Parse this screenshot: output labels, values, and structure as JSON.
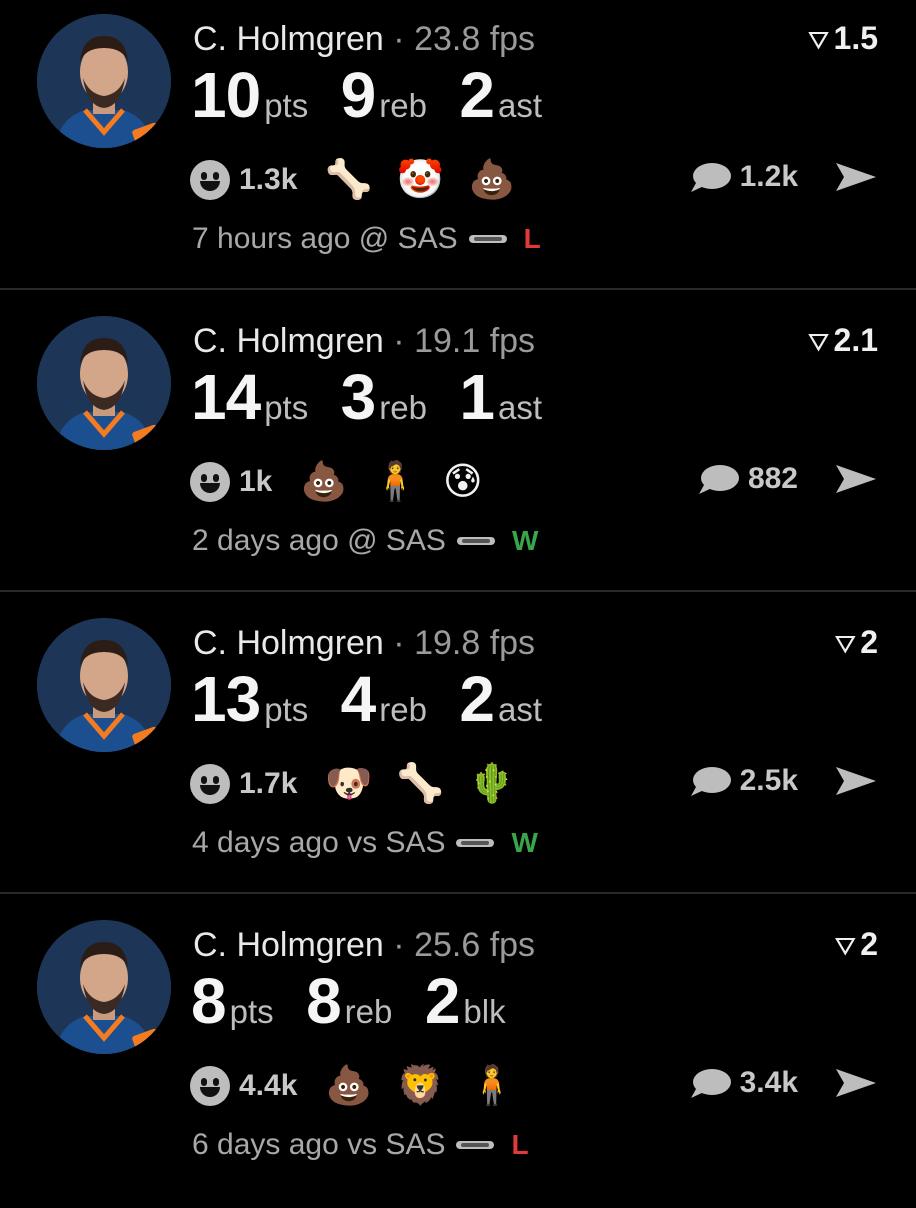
{
  "colors": {
    "win": "#3aa64a",
    "loss": "#e03a3a",
    "muted": "#a8a8a8"
  },
  "cards": [
    {
      "player": "C. Holmgren",
      "separator": "·",
      "fps": "23.8 fps",
      "rank_icon": "funnel-icon",
      "rank": "1.5",
      "stats": [
        {
          "num": "10",
          "unit": "pts"
        },
        {
          "num": "9",
          "unit": "reb"
        },
        {
          "num": "2",
          "unit": "ast"
        }
      ],
      "reaction_count": "1.3k",
      "reactions": [
        "🦴",
        "🤡",
        "💩"
      ],
      "comment_count": "1.2k",
      "time": "7 hours ago @ SAS",
      "result": "L"
    },
    {
      "player": "C. Holmgren",
      "separator": "·",
      "fps": "19.1 fps",
      "rank_icon": "funnel-icon",
      "rank": "2.1",
      "stats": [
        {
          "num": "14",
          "unit": "pts"
        },
        {
          "num": "3",
          "unit": "reb"
        },
        {
          "num": "1",
          "unit": "ast"
        }
      ],
      "reaction_count": "1k",
      "reactions": [
        "💩",
        "🧍",
        "😰"
      ],
      "comment_count": "882",
      "time": "2 days ago @ SAS",
      "result": "W"
    },
    {
      "player": "C. Holmgren",
      "separator": "·",
      "fps": "19.8 fps",
      "rank_icon": "funnel-icon",
      "rank": "2",
      "stats": [
        {
          "num": "13",
          "unit": "pts"
        },
        {
          "num": "4",
          "unit": "reb"
        },
        {
          "num": "2",
          "unit": "ast"
        }
      ],
      "reaction_count": "1.7k",
      "reactions": [
        "🐶",
        "🦴",
        "🌵"
      ],
      "comment_count": "2.5k",
      "time": "4 days ago vs SAS",
      "result": "W"
    },
    {
      "player": "C. Holmgren",
      "separator": "·",
      "fps": "25.6 fps",
      "rank_icon": "funnel-icon",
      "rank": "2",
      "stats": [
        {
          "num": "8",
          "unit": "pts"
        },
        {
          "num": "8",
          "unit": "reb"
        },
        {
          "num": "2",
          "unit": "blk"
        }
      ],
      "reaction_count": "4.4k",
      "reactions": [
        "💩",
        "🦁",
        "🧍"
      ],
      "comment_count": "3.4k",
      "time": "6 days ago vs SAS",
      "result": "L"
    }
  ]
}
